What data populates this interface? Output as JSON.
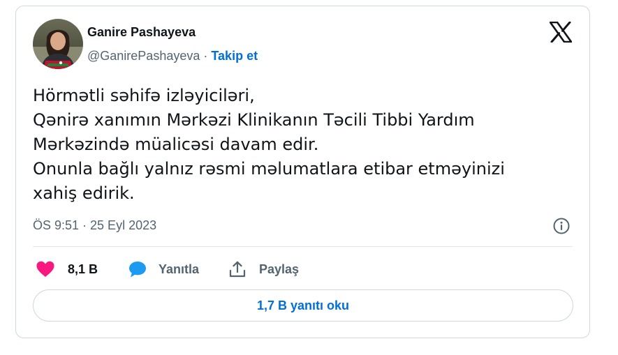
{
  "author": {
    "name": "Ganire Pashayeva",
    "handle": "@GanirePashayeva",
    "separator": "·",
    "follow_label": "Takip et"
  },
  "tweet": {
    "lines": [
      "Hörmətli səhifə izləyiciləri,",
      "Qənirə xanımın Mərkəzi Klinikanın Təcili Tibbi Yardım",
      "Mərkəzində müalicəsi davam edir.",
      "Onunla bağlı yalnız rəsmi məlumatlara etibar etməyinizi",
      "xahiş edirik."
    ],
    "timestamp": "ÖS 9:51 · 25 Eyl 2023"
  },
  "actions": {
    "likes_count": "8,1 B",
    "reply_label": "Yanıtla",
    "share_label": "Paylaş"
  },
  "read_replies_label": "1,7 B yanıtı oku",
  "icons": {
    "logo": "x-logo-icon",
    "info": "info-icon",
    "like": "heart-icon",
    "reply": "speech-bubble-icon",
    "share": "share-icon"
  },
  "colors": {
    "accent": "#006fd6",
    "like": "#f91880",
    "reply": "#1d9bf0",
    "muted": "#536471",
    "text": "#0f1419",
    "border": "#cfd9de"
  }
}
